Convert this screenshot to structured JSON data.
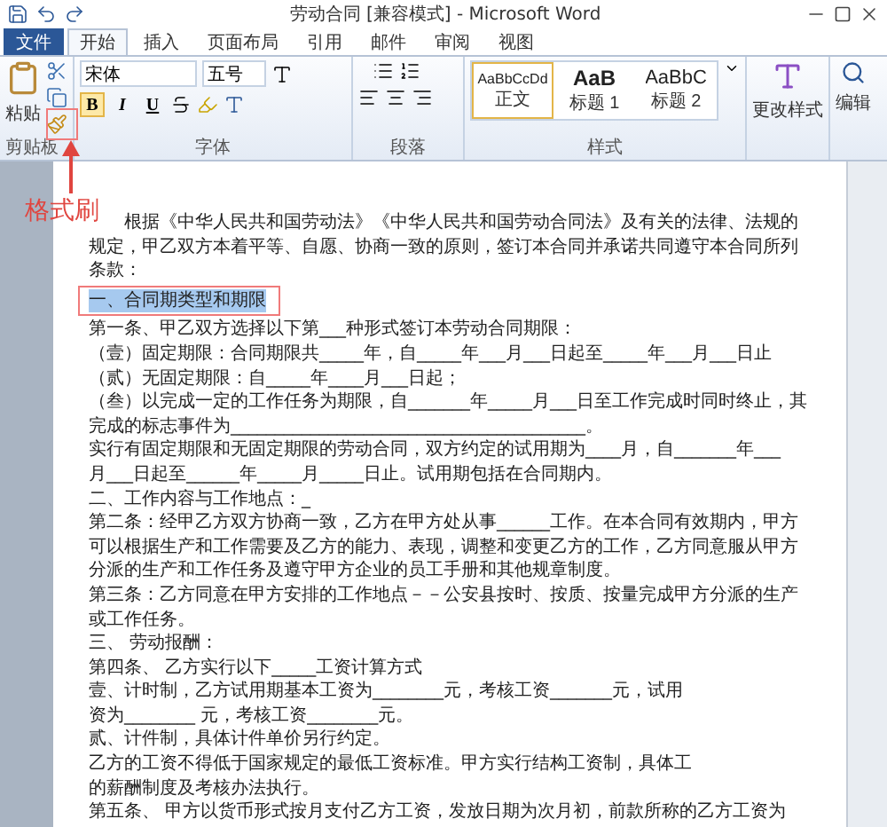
{
  "window": {
    "title": "劳动合同 [兼容模式] - Microsoft Word"
  },
  "tabs": [
    {
      "label": "文件",
      "kind": "file",
      "selected": false
    },
    {
      "label": "开始",
      "kind": "tab",
      "selected": true
    },
    {
      "label": "插入",
      "kind": "tab",
      "selected": false
    },
    {
      "label": "页面布局",
      "kind": "tab",
      "selected": false
    },
    {
      "label": "引用",
      "kind": "tab",
      "selected": false
    },
    {
      "label": "邮件",
      "kind": "tab",
      "selected": false
    },
    {
      "label": "审阅",
      "kind": "tab",
      "selected": false
    },
    {
      "label": "视图",
      "kind": "tab",
      "selected": false
    }
  ],
  "ribbon": {
    "clipboard": {
      "paste_label": "粘贴",
      "group_label": "剪贴板"
    },
    "font": {
      "font_name": "宋体",
      "font_size": "五号",
      "bold": "B",
      "italic": "I",
      "underline": "U",
      "group_label": "字体"
    },
    "paragraph": {
      "group_label": "段落"
    },
    "styles": {
      "items": [
        {
          "preview": "AaBbCcDd",
          "label": "正文",
          "selected": true
        },
        {
          "preview": "AaB",
          "label": "标题 1",
          "selected": false
        },
        {
          "preview": "AaBbC",
          "label": "标题 2",
          "selected": false
        }
      ],
      "group_label": "样式"
    },
    "change_styles": "更改样式",
    "editing": "编辑"
  },
  "document": {
    "lines": [
      {
        "text": "根据《中华人民共和国劳动法》《中华人民共和国劳动合同法》及有关的法律、法规的",
        "selected": false
      },
      {
        "text": "规定，甲乙双方本着平等、自愿、协商一致的原则，签订本合同并承诺共同遵守本合同所列",
        "selected": false
      },
      {
        "text": "条款：",
        "selected": false
      },
      {
        "text": "一、合同期类型和期限",
        "selected": true
      },
      {
        "text": "第一条、甲乙双方选择以下第___种形式签订本劳动合同期限：",
        "selected": false
      },
      {
        "text": "（壹）固定期限：合同期限共_____年，自_____年___月___日起至_____年___月___日止",
        "selected": false
      },
      {
        "text": "（贰）无固定期限：自_____年____月___日起；",
        "selected": false
      },
      {
        "text": "（叁）以完成一定的工作任务为期限，自_______年_____月___日至工作完成时同时终止，其",
        "selected": false
      },
      {
        "text": "完成的标志事件为________________________________________。",
        "selected": false
      },
      {
        "text": "实行有固定期限和无固定期限的劳动合同，双方约定的试用期为____月，自_______年___",
        "selected": false
      },
      {
        "text": "月___日起至______年_____月_____日止。试用期包括在合同期内。",
        "selected": false
      },
      {
        "text": "二、工作内容与工作地点：_",
        "selected": false
      },
      {
        "text": "第二条：经甲乙方双方协商一致，乙方在甲方处从事______工作。在本合同有效期内，甲方",
        "selected": false
      },
      {
        "text": "可以根据生产和工作需要及乙方的能力、表现，调整和变更乙方的工作，乙方同意服从甲方",
        "selected": false
      },
      {
        "text": "分派的生产和工作任务及遵守甲方企业的员工手册和其他规章制度。",
        "selected": false
      },
      {
        "text": "第三条：乙方同意在甲方安排的工作地点－－公安县按时、按质、按量完成甲方分派的生产",
        "selected": false
      },
      {
        "text": "或工作任务。",
        "selected": false
      },
      {
        "text": "三、 劳动报酬：",
        "selected": false
      },
      {
        "text": "第四条、 乙方实行以下_____工资计算方式",
        "selected": false
      },
      {
        "text": "壹、计时制，乙方试用期基本工资为________元，考核工资_______元，试用",
        "selected": false
      },
      {
        "text": "资为________ 元，考核工资________元。",
        "selected": false
      },
      {
        "text": "贰、计件制，具体计件单价另行约定。",
        "selected": false
      },
      {
        "text": "乙方的工资不得低于国家规定的最低工资标准。甲方实行结构工资制，具体工",
        "selected": false
      },
      {
        "text": "的薪酬制度及考核办法执行。",
        "selected": false
      },
      {
        "text": "第五条、 甲方以货币形式按月支付乙方工资，发放日期为次月初，前款所称的乙方工资为",
        "selected": false
      }
    ]
  },
  "annotation": {
    "label": "格式刷"
  }
}
